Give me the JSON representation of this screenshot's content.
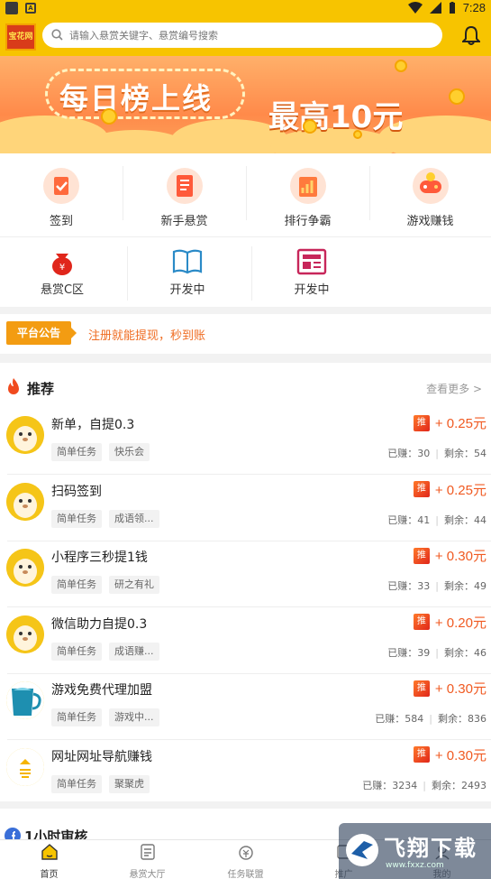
{
  "status_bar": {
    "time": "7:28"
  },
  "header": {
    "logo_text": "宝花网",
    "search_placeholder": "请输入悬赏关键字、悬赏编号搜索"
  },
  "banner": {
    "title": "每日榜上线",
    "subtitle": "最高10元"
  },
  "grid": {
    "row1": [
      {
        "label": "签到",
        "icon": "checkin-icon"
      },
      {
        "label": "新手悬赏",
        "icon": "newbie-reward-icon"
      },
      {
        "label": "排行争霸",
        "icon": "ranking-icon"
      },
      {
        "label": "游戏赚钱",
        "icon": "game-money-icon"
      }
    ],
    "row2": [
      {
        "label": "悬赏C区",
        "icon": "money-bag-icon"
      },
      {
        "label": "开发中",
        "icon": "book-icon"
      },
      {
        "label": "开发中",
        "icon": "news-icon"
      }
    ]
  },
  "notice": {
    "tag": "平台公告",
    "text": "注册就能提现，秒到账"
  },
  "recommend": {
    "title": "推荐",
    "more": "查看更多 >",
    "badge": "推",
    "earned_label": "已赚：",
    "left_label": "剩余：",
    "items": [
      {
        "name": "新单，自提0.3",
        "tags": [
          "简单任务",
          "快乐会"
        ],
        "price": "+ 0.25元",
        "earned": "30",
        "left": "54",
        "avatar": "hamster"
      },
      {
        "name": "扫码签到",
        "tags": [
          "简单任务",
          "成语领..."
        ],
        "price": "+ 0.25元",
        "earned": "41",
        "left": "44",
        "avatar": "hamster"
      },
      {
        "name": "小程序三秒提1钱",
        "tags": [
          "简单任务",
          "研之有礼"
        ],
        "price": "+ 0.30元",
        "earned": "33",
        "left": "49",
        "avatar": "hamster"
      },
      {
        "name": "微信助力自提0.3",
        "tags": [
          "简单任务",
          "成语赚..."
        ],
        "price": "+ 0.20元",
        "earned": "39",
        "left": "46",
        "avatar": "hamster"
      },
      {
        "name": "游戏免费代理加盟",
        "tags": [
          "简单任务",
          "游戏中..."
        ],
        "price": "+ 0.30元",
        "earned": "584",
        "left": "836",
        "avatar": "cup"
      },
      {
        "name": "网址网址导航赚钱",
        "tags": [
          "简单任务",
          "聚聚虎"
        ],
        "price": "+ 0.30元",
        "earned": "3234",
        "left": "2493",
        "avatar": "arrows"
      }
    ]
  },
  "next_section": {
    "title": "1小时审核"
  },
  "tabbar": [
    {
      "label": "首页",
      "icon": "home-icon",
      "active": true
    },
    {
      "label": "悬赏大厅",
      "icon": "list-icon",
      "active": false
    },
    {
      "label": "任务联盟",
      "icon": "money-icon",
      "active": false
    },
    {
      "label": "推广",
      "icon": "share-icon",
      "active": false
    },
    {
      "label": "我的",
      "icon": "user-icon",
      "active": false
    }
  ],
  "watermark": {
    "title": "飞翔下载",
    "url": "www.fxxz.com"
  },
  "colors": {
    "brand": "#f7c400",
    "accent": "#f05a22"
  }
}
